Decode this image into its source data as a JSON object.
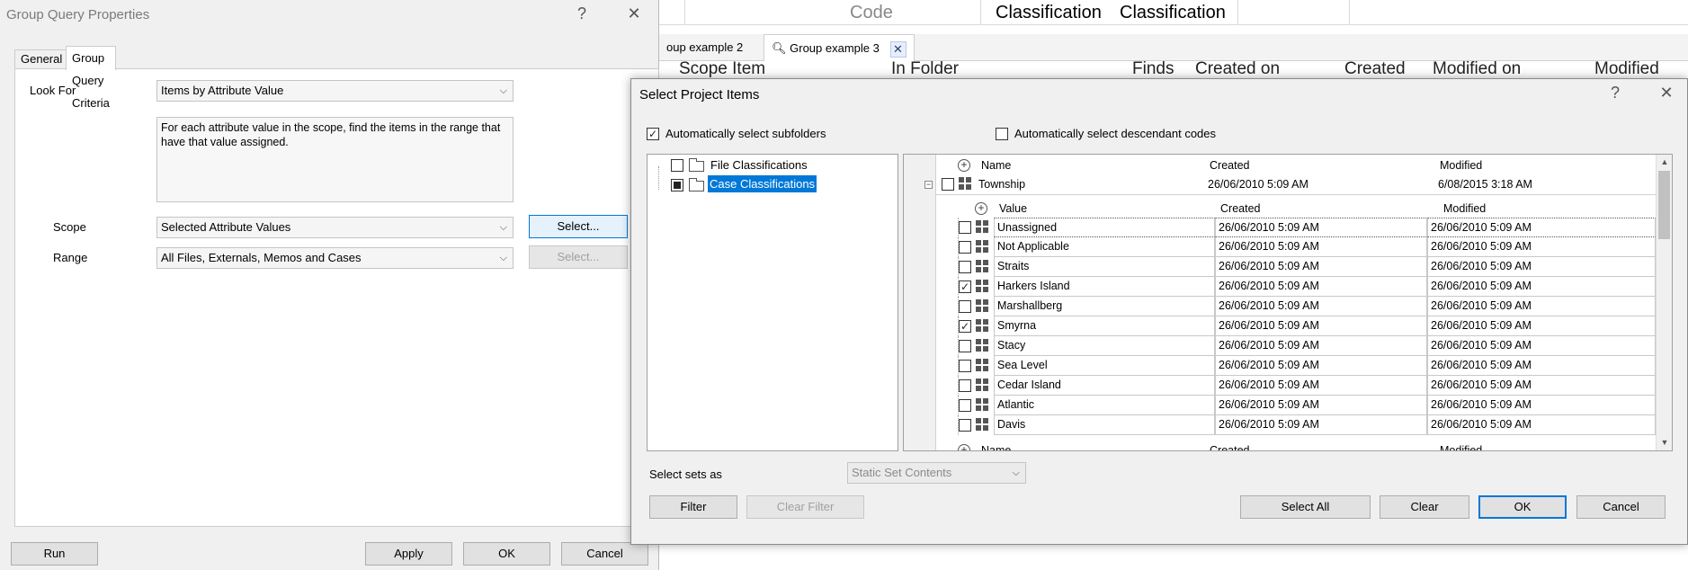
{
  "background": {
    "columns": [
      "Code",
      "Classification",
      "Classification"
    ],
    "tabs": [
      "oup example 2",
      "Group example 3"
    ],
    "tab_close_icon": "close-icon",
    "search_icon": "search-icon",
    "header2": [
      "Scope Item",
      "In Folder",
      "Finds",
      "Created on",
      "Created",
      "Modified on",
      "Modified"
    ]
  },
  "group_query": {
    "title": "Group Query Properties",
    "help": "?",
    "close": "✕",
    "tabs": [
      "General",
      "Group Query Criteria"
    ],
    "look_for_label": "Look For",
    "look_for_value": "Items by Attribute Value",
    "description": "For each attribute value in the scope, find the items in the range that have that value assigned.",
    "scope_label": "Scope",
    "scope_value": "Selected Attribute Values",
    "scope_select": "Select...",
    "range_label": "Range",
    "range_value": "All Files, Externals, Memos and Cases",
    "range_select": "Select...",
    "buttons": {
      "run": "Run",
      "apply": "Apply",
      "ok": "OK",
      "cancel": "Cancel"
    }
  },
  "select_items": {
    "title": "Select Project Items",
    "help": "?",
    "close": "✕",
    "auto_subfolders": "Automatically select subfolders",
    "auto_subfolders_checked": true,
    "auto_descendant": "Automatically select descendant codes",
    "auto_descendant_checked": false,
    "tree": [
      {
        "label": "File Classifications",
        "state": "unchecked",
        "selected": false
      },
      {
        "label": "Case Classifications",
        "state": "partial",
        "selected": true
      }
    ],
    "outer_headers": {
      "name": "Name",
      "created": "Created",
      "modified": "Modified"
    },
    "classification": {
      "name": "Township",
      "created": "26/06/2010 5:09 AM",
      "modified": "6/08/2015 3:18 AM"
    },
    "inner_headers": {
      "value": "Value",
      "created": "Created",
      "modified": "Modified"
    },
    "rows": [
      {
        "value": "Unassigned",
        "created": "26/06/2010 5:09 AM",
        "modified": "26/06/2010 5:09 AM",
        "checked": false
      },
      {
        "value": "Not Applicable",
        "created": "26/06/2010 5:09 AM",
        "modified": "26/06/2010 5:09 AM",
        "checked": false
      },
      {
        "value": "Straits",
        "created": "26/06/2010 5:09 AM",
        "modified": "26/06/2010 5:09 AM",
        "checked": false
      },
      {
        "value": "Harkers Island",
        "created": "26/06/2010 5:09 AM",
        "modified": "26/06/2010 5:09 AM",
        "checked": true
      },
      {
        "value": "Marshallberg",
        "created": "26/06/2010 5:09 AM",
        "modified": "26/06/2010 5:09 AM",
        "checked": false
      },
      {
        "value": "Smyrna",
        "created": "26/06/2010 5:09 AM",
        "modified": "26/06/2010 5:09 AM",
        "checked": true
      },
      {
        "value": "Stacy",
        "created": "26/06/2010 5:09 AM",
        "modified": "26/06/2010 5:09 AM",
        "checked": false
      },
      {
        "value": "Sea Level",
        "created": "26/06/2010 5:09 AM",
        "modified": "26/06/2010 5:09 AM",
        "checked": false
      },
      {
        "value": "Cedar Island",
        "created": "26/06/2010 5:09 AM",
        "modified": "26/06/2010 5:09 AM",
        "checked": false
      },
      {
        "value": "Atlantic",
        "created": "26/06/2010 5:09 AM",
        "modified": "26/06/2010 5:09 AM",
        "checked": false
      },
      {
        "value": "Davis",
        "created": "26/06/2010 5:09 AM",
        "modified": "26/06/2010 5:09 AM",
        "checked": false
      }
    ],
    "trailing_headers": {
      "name": "Name",
      "created": "Created",
      "modified": "Modified"
    },
    "select_sets_label": "Select sets as",
    "select_sets_value": "Static Set Contents",
    "buttons": {
      "filter": "Filter",
      "clear_filter": "Clear Filter",
      "select_all": "Select All",
      "clear": "Clear",
      "ok": "OK",
      "cancel": "Cancel"
    }
  }
}
